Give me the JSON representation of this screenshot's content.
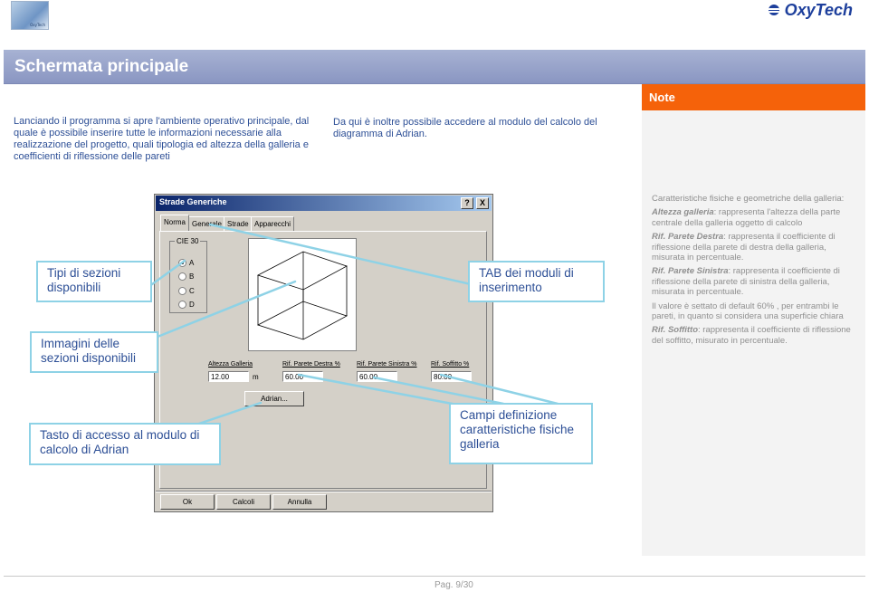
{
  "header": {
    "logo_icon": "oxytech-document-logo",
    "logo_caption": "OxyTech",
    "brand_icon": "oxytech-mark",
    "brand_name": "OxyTech",
    "brand_color": "#1d3f9c"
  },
  "title": "Schermata principale",
  "note": {
    "heading": "Note",
    "heading_color": "#f5620a",
    "lines": [
      {
        "plain": "Caratteristiche fisiche e geometriche della galleria:"
      },
      {
        "term": "Altezza galleria",
        "text": ": rappresenta l'altezza della parte centrale della galleria oggetto di calcolo"
      },
      {
        "term": "Rif. Parete Destra",
        "text": ": rappresenta il coefficiente di riflessione  della parete di destra della galleria, misurata in percentuale."
      },
      {
        "term": "Rif. Parete Sinistra",
        "text": ": rappresenta il coefficiente di riflessione della parete di sinistra della galleria, misurata in percentuale."
      },
      {
        "plain": "Il valore è settato di default  60% , per entrambi le pareti, in quanto si considera una superficie chiara"
      },
      {
        "term": "Rif. Soffitto",
        "text": ": rappresenta il coefficiente di riflessione del soffitto, misurato in percentuale."
      }
    ]
  },
  "intro_left": "Lanciando il programma si apre l'ambiente operativo principale, dal quale è possibile inserire tutte le informazioni necessarie alla realizzazione del progetto, quali tipologia ed altezza della galleria e coefficienti di riflessione delle pareti",
  "intro_right": "Da qui è inoltre possibile accedere al modulo del calcolo del diagramma di Adrian.",
  "dialog": {
    "title": "Strade Generiche",
    "help_button": "?",
    "close_button": "X",
    "tabs": [
      "Norma",
      "Generale",
      "Strade",
      "Apparecchi"
    ],
    "active_tab": "Norma",
    "group_label": "CIE 30",
    "options": [
      "A",
      "B",
      "C",
      "D"
    ],
    "selected_option": "A",
    "fields": [
      {
        "label": "Altezza Galleria",
        "value": "12.00",
        "unit": "m"
      },
      {
        "label": "Rif. Parete Destra %",
        "value": "60.00"
      },
      {
        "label": "Rif. Parete Sinistra %",
        "value": "60.00"
      },
      {
        "label": "Rif. Soffitto %",
        "value": "80.00"
      }
    ],
    "adrian_button": "Adrian...",
    "buttons": {
      "ok": "Ok",
      "calc": "Calcoli",
      "cancel": "Annulla"
    }
  },
  "callouts": {
    "sections": "Tipi di sezioni disponibili",
    "images": "Immagini delle sezioni disponibili",
    "tabs": "TAB dei moduli di inserimento",
    "adrian": "Tasto di accesso al modulo di calcolo di Adrian",
    "fields": "Campi definizione caratteristiche fisiche galleria"
  },
  "footer": {
    "page": "Pag. 9/30"
  }
}
